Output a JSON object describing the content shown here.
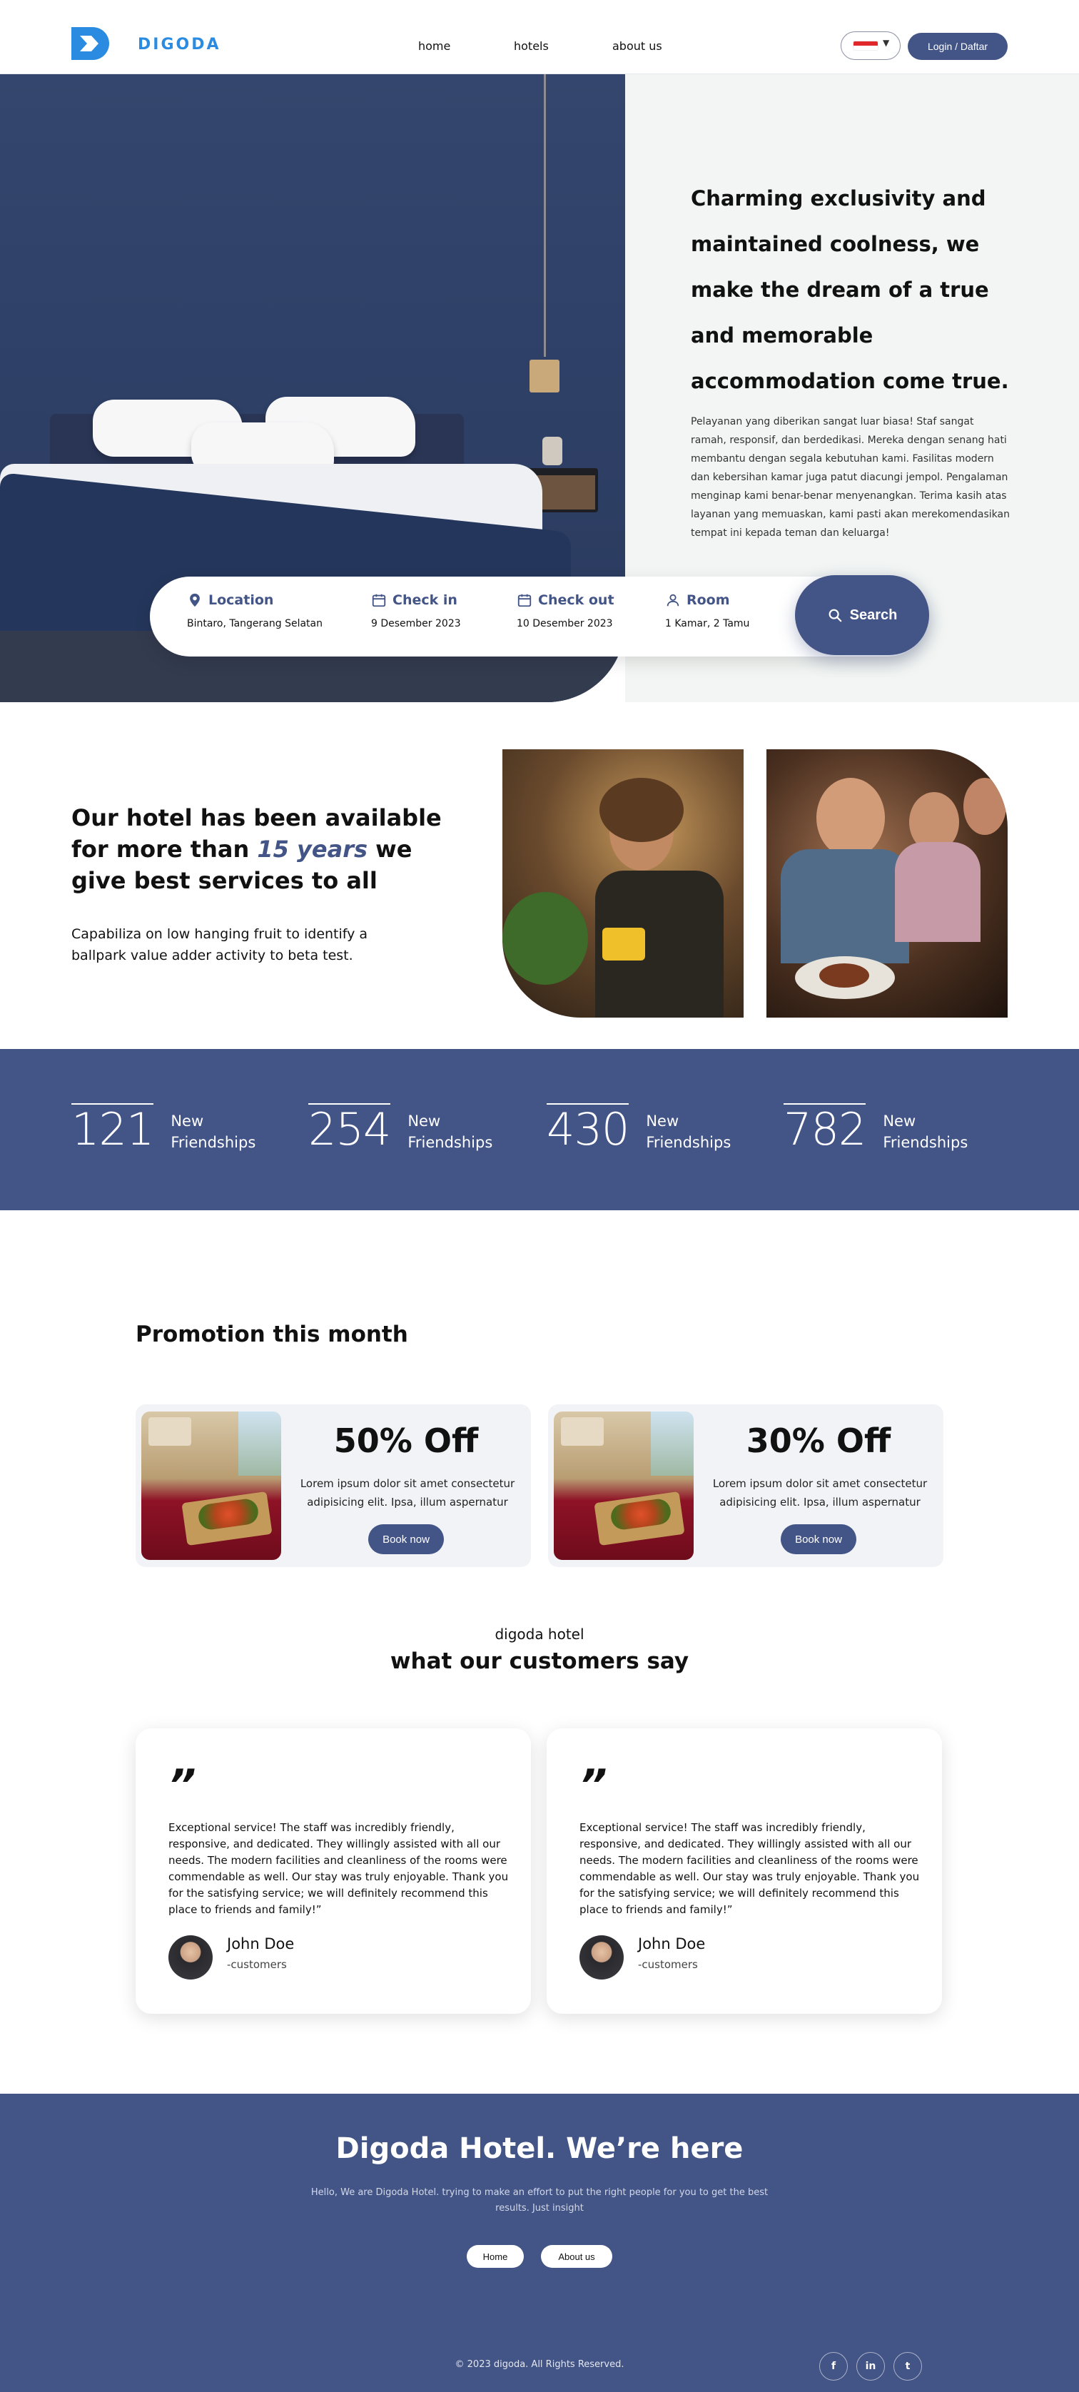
{
  "brand": {
    "name": "DIGODA",
    "accent": "#435486",
    "logo_color": "#2b8be0"
  },
  "nav": {
    "links": [
      "home",
      "hotels",
      "about us"
    ],
    "language_flag": "indonesia-flag-icon",
    "login_label": "Login / Daftar"
  },
  "hero": {
    "title": "Charming exclusivity and maintained coolness, we make the dream of a true and memorable accommodation come true.",
    "description": "Pelayanan yang diberikan sangat luar biasa! Staf sangat ramah, responsif, dan berdedikasi. Mereka dengan senang hati membantu dengan segala kebutuhan kami. Fasilitas modern dan kebersihan kamar juga patut diacungi jempol. Pengalaman menginap kami benar-benar menyenangkan. Terima kasih atas layanan yang memuaskan, kami pasti akan merekomendasikan tempat ini kepada teman dan keluarga!"
  },
  "search": {
    "location": {
      "label": "Location",
      "value": "Bintaro, Tangerang Selatan"
    },
    "checkin": {
      "label": "Check in",
      "value": "9 Desember 2023"
    },
    "checkout": {
      "label": "Check out",
      "value": "10 Desember 2023"
    },
    "room": {
      "label": "Room",
      "value": "1 Kamar, 2 Tamu"
    },
    "button_label": "Search"
  },
  "about": {
    "title_before": "Our hotel has been available for more than ",
    "title_highlight": "15 years",
    "title_after": " we give best services to all",
    "description": "Capabiliza on low hanging fruit to identify a ballpark value adder activity to beta test."
  },
  "stats": [
    {
      "number": "121",
      "label_line1": "New",
      "label_line2": "Friendships"
    },
    {
      "number": "254",
      "label_line1": "New",
      "label_line2": "Friendships"
    },
    {
      "number": "430",
      "label_line1": "New",
      "label_line2": "Friendships"
    },
    {
      "number": "782",
      "label_line1": "New",
      "label_line2": "Friendships"
    }
  ],
  "promotions": {
    "title": "Promotion this month",
    "items": [
      {
        "off": "50% Off",
        "description": "Lorem ipsum dolor sit amet consectetur adipisicing elit. Ipsa, illum aspernatur",
        "button": "Book now"
      },
      {
        "off": "30% Off",
        "description": "Lorem ipsum dolor sit amet consectetur adipisicing elit. Ipsa, illum aspernatur",
        "button": "Book now"
      }
    ]
  },
  "testimonials": {
    "subtitle": "digoda hotel",
    "title": "what our customers say",
    "items": [
      {
        "quote_mark": "”",
        "text": "Exceptional service! The staff was incredibly friendly, responsive, and dedicated. They willingly assisted with all our needs. The modern facilities and cleanliness of the rooms were commendable as well. Our stay was truly enjoyable. Thank you for the satisfying service; we will definitely recommend this place to friends and family!”",
        "name": "John Doe",
        "role": "-customers"
      },
      {
        "quote_mark": "”",
        "text": "Exceptional service! The staff was incredibly friendly, responsive, and dedicated. They willingly assisted with all our needs. The modern facilities and cleanliness of the rooms were commendable as well. Our stay was truly enjoyable. Thank you for the satisfying service; we will definitely recommend this place to friends and family!”",
        "name": "John Doe",
        "role": "-customers"
      }
    ]
  },
  "footer": {
    "title": "Digoda Hotel. We’re here",
    "description": "Hello, We are Digoda Hotel. trying to make an effort to put the right people for you to get the best results. Just insight",
    "buttons": [
      "Home",
      "About us"
    ],
    "copyright": "© 2023 digoda. All Rights Reserved.",
    "social": [
      {
        "icon": "facebook-icon",
        "glyph": "f"
      },
      {
        "icon": "linkedin-icon",
        "glyph": "in"
      },
      {
        "icon": "twitter-icon",
        "glyph": "t"
      }
    ]
  }
}
